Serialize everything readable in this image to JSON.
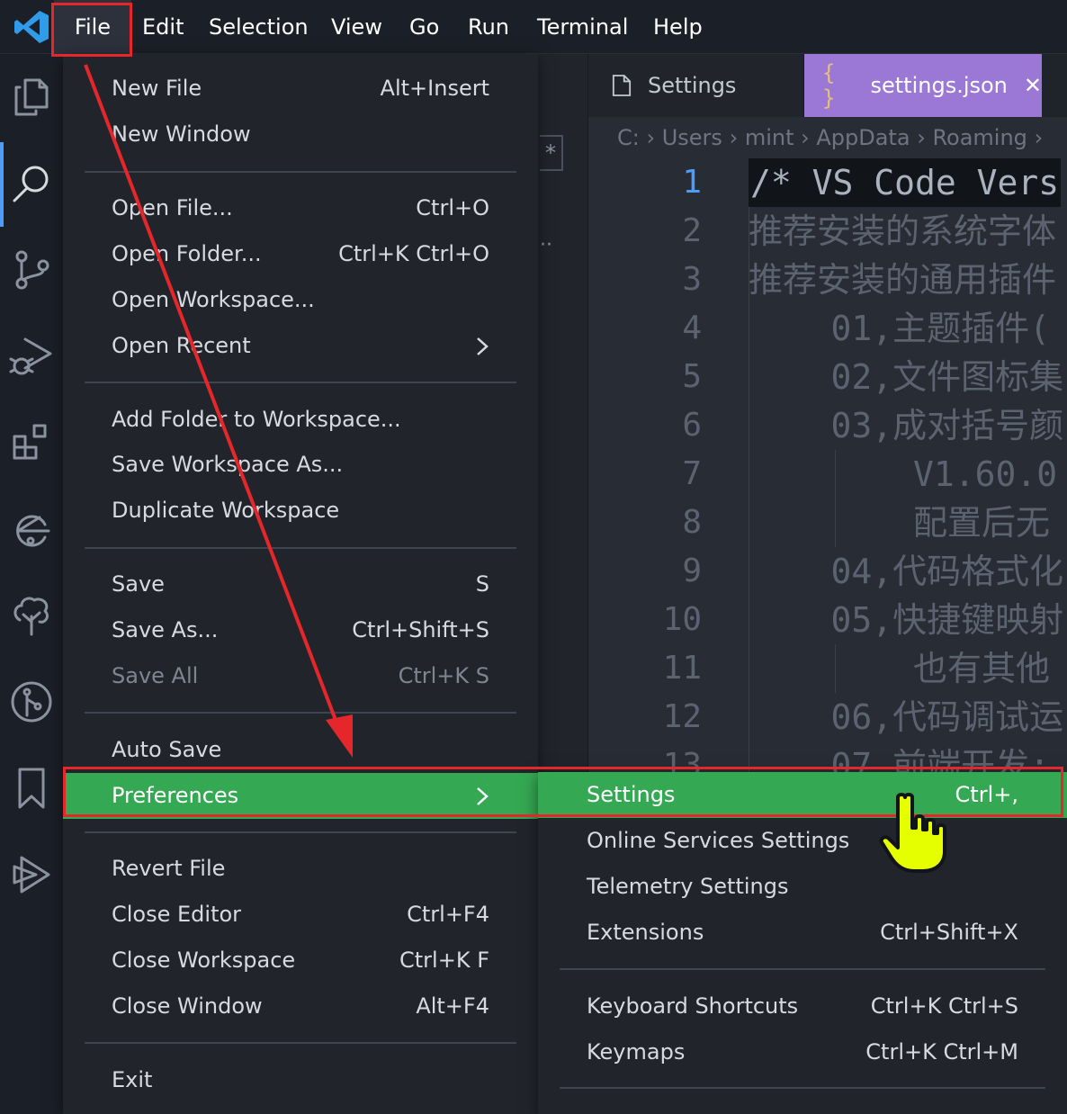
{
  "menubar": {
    "items": [
      "File",
      "Edit",
      "Selection",
      "View",
      "Go",
      "Run",
      "Terminal",
      "Help"
    ],
    "active": "File"
  },
  "activity_bar": {
    "icons": [
      "files-icon",
      "search-icon",
      "source-control-icon",
      "run-debug-icon",
      "extensions-icon",
      "remote-explorer-icon",
      "tree-icon",
      "git-graph-icon",
      "bookmark-icon",
      "live-share-icon"
    ],
    "active": "search-icon"
  },
  "editor": {
    "tabs": [
      {
        "label": "Settings",
        "icon": "file-icon"
      },
      {
        "label": "settings.json",
        "icon": "braces-icon",
        "close": "✕"
      }
    ],
    "breadcrumb": [
      "C:",
      "Users",
      "mint",
      "AppData",
      "Roaming"
    ],
    "line_numbers": [
      "1",
      "2",
      "3",
      "4",
      "5",
      "6",
      "7",
      "8",
      "9",
      "10",
      "11",
      "12",
      "13"
    ],
    "lines": [
      "/* VS Code Vers",
      "推荐安装的系统字体",
      "推荐安装的通用插件",
      "    01,主题插件(",
      "    02,文件图标集",
      "    03,成对括号颜",
      "        V1.60.0",
      "        配置后无",
      "    04,代码格式化",
      "    05,快捷键映射",
      "        也有其他",
      "    06,代码调试运",
      "    07,前端开发:"
    ]
  },
  "file_menu": {
    "groups": [
      [
        {
          "label": "New File",
          "shortcut": "Alt+Insert"
        },
        {
          "label": "New Window",
          "shortcut": ""
        }
      ],
      [
        {
          "label": "Open File...",
          "shortcut": "Ctrl+O"
        },
        {
          "label": "Open Folder...",
          "shortcut": "Ctrl+K Ctrl+O"
        },
        {
          "label": "Open Workspace...",
          "shortcut": ""
        },
        {
          "label": "Open Recent",
          "shortcut": "",
          "submenu": true
        }
      ],
      [
        {
          "label": "Add Folder to Workspace...",
          "shortcut": ""
        },
        {
          "label": "Save Workspace As...",
          "shortcut": ""
        },
        {
          "label": "Duplicate Workspace",
          "shortcut": ""
        }
      ],
      [
        {
          "label": "Save",
          "shortcut": "S"
        },
        {
          "label": "Save As...",
          "shortcut": "Ctrl+Shift+S"
        },
        {
          "label": "Save All",
          "shortcut": "Ctrl+K S",
          "disabled": true
        }
      ],
      [
        {
          "label": "Auto Save",
          "shortcut": ""
        },
        {
          "label": "Preferences",
          "shortcut": "",
          "submenu": true,
          "highlighted": true
        }
      ],
      [
        {
          "label": "Revert File",
          "shortcut": ""
        },
        {
          "label": "Close Editor",
          "shortcut": "Ctrl+F4"
        },
        {
          "label": "Close Workspace",
          "shortcut": "Ctrl+K F"
        },
        {
          "label": "Close Window",
          "shortcut": "Alt+F4"
        }
      ],
      [
        {
          "label": "Exit",
          "shortcut": ""
        }
      ]
    ]
  },
  "preferences_submenu": {
    "groups": [
      [
        {
          "label": "Settings",
          "shortcut": "Ctrl+,",
          "highlighted": true
        },
        {
          "label": "Online Services Settings",
          "shortcut": ""
        },
        {
          "label": "Telemetry Settings",
          "shortcut": ""
        },
        {
          "label": "Extensions",
          "shortcut": "Ctrl+Shift+X"
        }
      ],
      [
        {
          "label": "Keyboard Shortcuts",
          "shortcut": "Ctrl+K Ctrl+S"
        },
        {
          "label": "Keymaps",
          "shortcut": "Ctrl+K Ctrl+M"
        }
      ]
    ]
  },
  "colors": {
    "highlight": "#35a853",
    "annotation_red": "#e5262b",
    "accent_blue": "#4d9cf7",
    "tab_active": "#9b78d6",
    "cursor_yellow": "#e6ff00"
  }
}
